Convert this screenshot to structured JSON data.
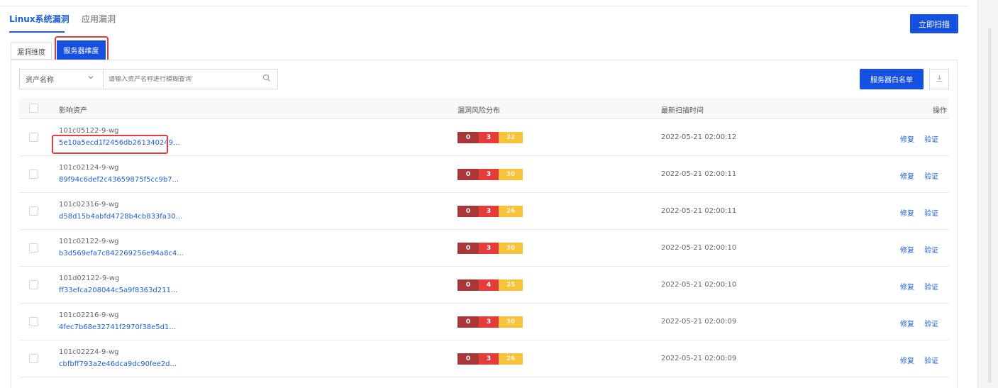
{
  "tabs": [
    {
      "label": "Linux系统漏洞",
      "active": true
    },
    {
      "label": "应用漏洞",
      "active": false
    }
  ],
  "scan_button": "立即扫描",
  "segments": {
    "vuln_dim": "漏洞维度",
    "server_dim": "服务器维度",
    "selected": "服务器维度"
  },
  "filter": {
    "select_value": "资产名称",
    "search_placeholder": "请输入资产名称进行模糊查询"
  },
  "whitelist_button": "服务器白名单",
  "table": {
    "headers": {
      "asset": "影响资产",
      "risk": "漏洞风险分布",
      "scan_time": "最新扫描时间",
      "actions": "操作"
    },
    "action_labels": {
      "fix": "修复",
      "verify": "验证"
    },
    "rows": [
      {
        "name": "101c05122-9-wg",
        "id": "5e10a5ecd1f2456db261340249...",
        "critical": "0",
        "high": "3",
        "medium": "32",
        "time": "2022-05-21 02:00:12"
      },
      {
        "name": "101c02124-9-wg",
        "id": "89f94c6def2c43659875f5cc9b7...",
        "critical": "0",
        "high": "3",
        "medium": "30",
        "time": "2022-05-21 02:00:11"
      },
      {
        "name": "101c02316-9-wg",
        "id": "d58d15b4abfd4728b4cb833fa30...",
        "critical": "0",
        "high": "3",
        "medium": "26",
        "time": "2022-05-21 02:00:11"
      },
      {
        "name": "101c02122-9-wg",
        "id": "b3d569efa7c842269256e94a8c4...",
        "critical": "0",
        "high": "3",
        "medium": "30",
        "time": "2022-05-21 02:00:10"
      },
      {
        "name": "101d02122-9-wg",
        "id": "ff33efca208044c5a9f8363d211...",
        "critical": "0",
        "high": "4",
        "medium": "35",
        "time": "2022-05-21 02:00:10"
      },
      {
        "name": "101c02216-9-wg",
        "id": "4fec7b68e32741f2970f38e5d1...",
        "critical": "0",
        "high": "3",
        "medium": "30",
        "time": "2022-05-21 02:00:09"
      },
      {
        "name": "101c02224-9-wg",
        "id": "cbfbff793a2e46dca9dc90fee2d...",
        "critical": "0",
        "high": "3",
        "medium": "26",
        "time": "2022-05-21 02:00:09"
      }
    ]
  },
  "colors": {
    "primary": "#1550e0",
    "link": "#1f5fd6",
    "risk_critical": "#a93737",
    "risk_high": "#e53b3b",
    "risk_medium": "#f7c23c",
    "highlight_annotation": "#e33d3d"
  }
}
